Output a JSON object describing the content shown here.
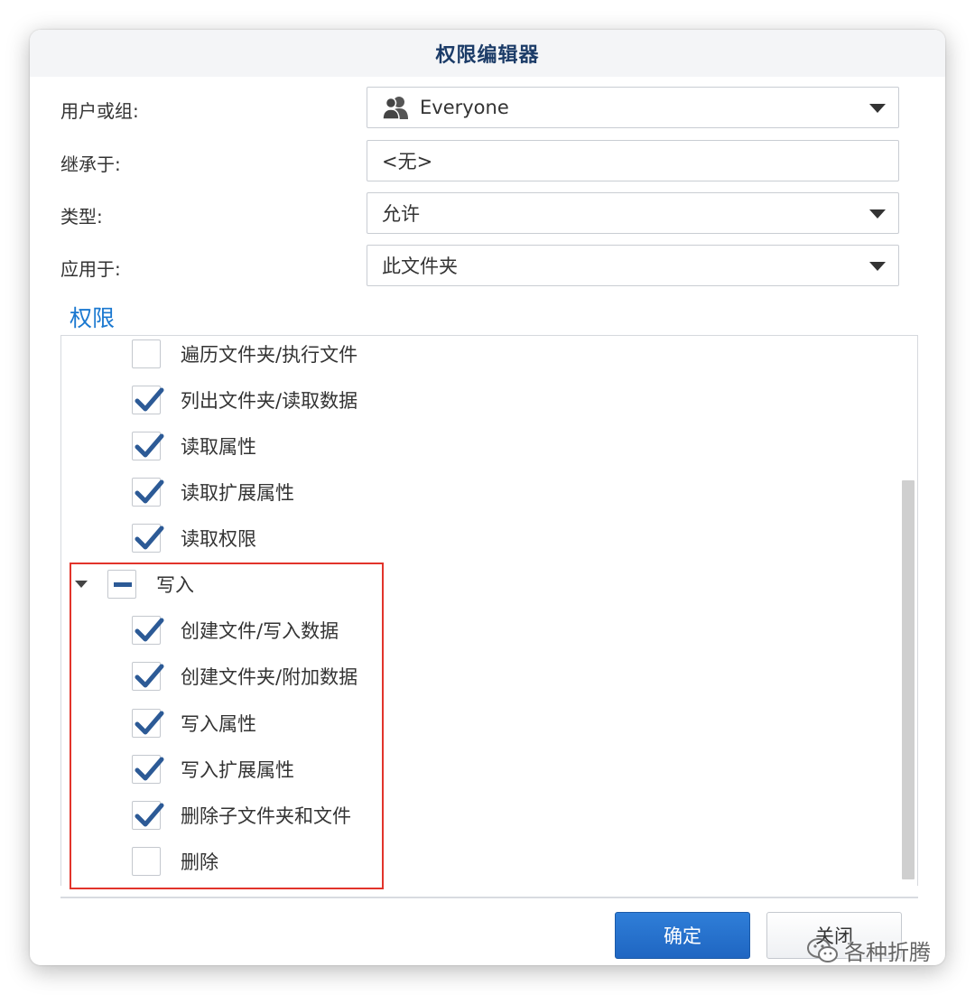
{
  "dialog": {
    "title": "权限编辑器",
    "user_label": "用户或组:",
    "user_value": "Everyone",
    "inherit_label": "继承于:",
    "inherit_value": "<无>",
    "type_label": "类型:",
    "type_value": "允许",
    "apply_label": "应用于:",
    "apply_value": "此文件夹",
    "permissions_title": "权限",
    "permissions": [
      {
        "label": "遍历文件夹/执行文件",
        "checked": false
      },
      {
        "label": "列出文件夹/读取数据",
        "checked": true
      },
      {
        "label": "读取属性",
        "checked": true
      },
      {
        "label": "读取扩展属性",
        "checked": true
      },
      {
        "label": "读取权限",
        "checked": true
      }
    ],
    "write_group": {
      "label": "写入",
      "state": "partial",
      "items": [
        {
          "label": "创建文件/写入数据",
          "checked": true
        },
        {
          "label": "创建文件夹/附加数据",
          "checked": true
        },
        {
          "label": "写入属性",
          "checked": true
        },
        {
          "label": "写入扩展属性",
          "checked": true
        },
        {
          "label": "删除子文件夹和文件",
          "checked": true
        },
        {
          "label": "删除",
          "checked": false
        }
      ]
    },
    "ok_label": "确定",
    "close_label": "关闭"
  },
  "watermark": "各种折腾",
  "colors": {
    "accent": "#1a78d0",
    "title": "#1c3c68",
    "check": "#2c5a96",
    "primary_button": "#2a74d0",
    "highlight": "#e2342b"
  }
}
